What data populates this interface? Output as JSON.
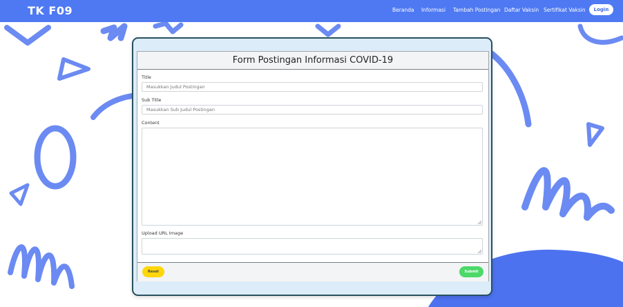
{
  "navbar": {
    "brand": "TK F09",
    "links": [
      {
        "label": "Beranda"
      },
      {
        "label": "Informasi"
      },
      {
        "label": "Tambah Postingan"
      },
      {
        "label": "Daftar Vaksin"
      },
      {
        "label": "Sertifikat Vaksin"
      }
    ],
    "login_label": "Login",
    "color": "#4e79f2"
  },
  "form": {
    "title": "Form Postingan Informasi COVID-19",
    "fields": {
      "title": {
        "label": "Title",
        "placeholder": "Masukkan Judul Postingan",
        "value": ""
      },
      "subtitle": {
        "label": "Sub Title",
        "placeholder": "Masukkan Sub Judul Postingan",
        "value": ""
      },
      "content": {
        "label": "Content",
        "value": ""
      },
      "image": {
        "label": "Upload URL Image",
        "value": ""
      }
    },
    "reset_label": "Reset",
    "submit_label": "Submit",
    "reset_color": "#ffd60a",
    "submit_color": "#4bd96a"
  },
  "background": {
    "shape_color": "#5b7ff0"
  }
}
